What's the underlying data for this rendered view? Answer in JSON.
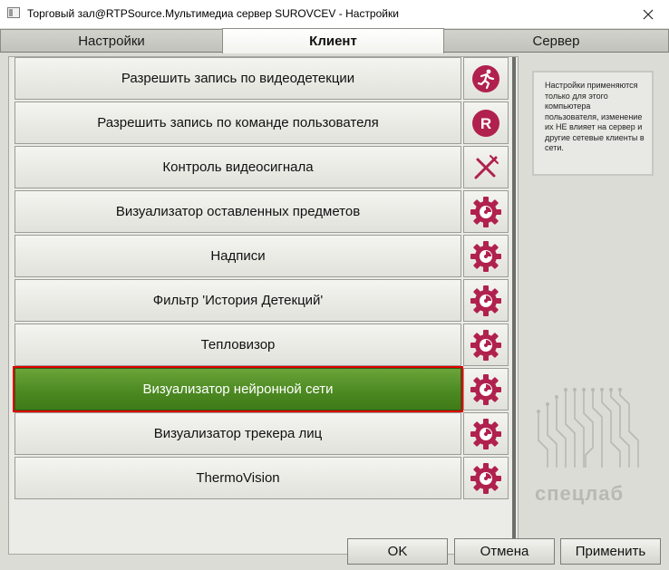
{
  "window": {
    "title": "Торговый зал@RTPSource.Мультимедиа сервер SUROVCEV - Настройки"
  },
  "tabs": [
    {
      "label": "Настройки",
      "active": false
    },
    {
      "label": "Клиент",
      "active": true
    },
    {
      "label": "Сервер",
      "active": false
    }
  ],
  "items": [
    {
      "label": "Разрешить запись по видеодетекции",
      "icon": "runner-icon"
    },
    {
      "label": "Разрешить запись по команде пользователя",
      "icon": "record-r-icon"
    },
    {
      "label": "Контроль видеосигнала",
      "icon": "signal-cross-icon"
    },
    {
      "label": "Визуализатор оставленных предметов",
      "icon": "gear-icon"
    },
    {
      "label": "Надписи",
      "icon": "gear-icon"
    },
    {
      "label": "Фильтр 'История Детекций'",
      "icon": "gear-icon"
    },
    {
      "label": "Тепловизор",
      "icon": "gear-icon"
    },
    {
      "label": "Визуализатор нейронной сети",
      "icon": "gear-icon",
      "selected": true
    },
    {
      "label": "Визуализатор трекера лиц",
      "icon": "gear-icon"
    },
    {
      "label": "ThermoVision",
      "icon": "gear-icon"
    }
  ],
  "info": {
    "text": "Настройки применяются только для этого компьютера пользователя, изменение их НЕ влияет на сервер и другие сетевые клиенты в сети."
  },
  "brand": {
    "name": "спецлаб"
  },
  "buttons": {
    "ok": "OK",
    "cancel": "Отмена",
    "apply": "Применить"
  },
  "colors": {
    "icon_accent": "#b0214e",
    "selected_green": "#4d8a22",
    "selection_outline": "#e00000"
  }
}
